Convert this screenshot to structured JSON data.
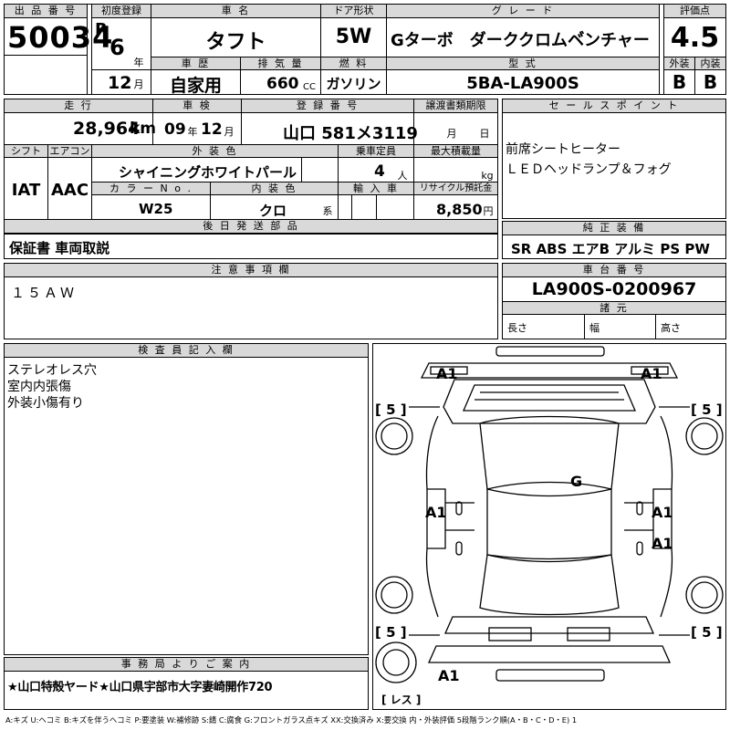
{
  "header": {
    "lot_label": "出 品 番 号",
    "lot_number": "50034",
    "first_reg_label": "初度登録",
    "era": "R",
    "reg_year": "6",
    "year_unit": "年",
    "reg_month": "12",
    "month_unit": "月",
    "car_name_label": "車 名",
    "car_name": "タフト",
    "door_label": "ドア形状",
    "door": "5W",
    "grade_label": "グ レ ー ド",
    "grade": "Gターボ　ダーククロムベ゙ンチャー",
    "score_label": "評価点",
    "score": "4.5",
    "history_label": "車 歴",
    "history": "自家用",
    "displacement_label": "排 気 量",
    "displacement": "660",
    "cc_unit": "CC",
    "fuel_label": "燃 料",
    "fuel": "ガソリン",
    "model_label": "型 式",
    "model": "5BA-LA900S",
    "exterior_label": "外装",
    "exterior_grade": "B",
    "interior_label": "内装",
    "interior_grade": "B"
  },
  "row2": {
    "mileage_label": "走 行",
    "mileage": "28,964",
    "km_unit": "km",
    "inspection_label": "車 検",
    "insp_year": "09",
    "year_unit": "年",
    "insp_month": "12",
    "month_unit": "月",
    "plate_label": "登 録 番 号",
    "plate": "山口 581メ3119",
    "transfer_label": "譲渡書類期限",
    "transfer_month_unit": "月",
    "transfer_day_unit": "日",
    "shift_label": "シフト",
    "shift": "IAT",
    "aircon_label": "エアコン",
    "aircon": "AAC",
    "color_label": "外 装 色",
    "color": "シャイニング゙ホワイトパール",
    "capacity_label": "乗車定員",
    "capacity": "4",
    "person_unit": "人",
    "load_label": "最大積載量",
    "kg_unit": "kg",
    "color_no_label": "カ ラ ー N o .",
    "color_no": "W25",
    "interior_color_label": "内 装 色",
    "interior_color": "クロ",
    "interior_unit": "系",
    "import_label": "輸 入 車",
    "recycle_label": "リサイクル預託金",
    "recycle": "8,850",
    "yen_unit": "円"
  },
  "sales_point": {
    "label": "セ ー ル ス ポ イ ン ト",
    "lines": [
      "前席シートヒーター",
      "ＬＥＤヘッドランプ＆フォグ"
    ]
  },
  "later_parts": {
    "label": "後 日 発 送 部 品",
    "value": "保証書 車両取説"
  },
  "equipment": {
    "label": "純 正 装 備",
    "value": "SR ABS エアB アルミ PS PW"
  },
  "notes": {
    "label": "注 意 事 項 欄",
    "value": "１５ＡＷ"
  },
  "chassis": {
    "label": "車 台 番 号",
    "value": "LA900S-0200967",
    "dims_label": "諸 元",
    "length_label": "長さ",
    "width_label": "幅",
    "height_label": "高さ"
  },
  "inspector": {
    "label": "検 査 員 記 入 欄",
    "lines": [
      "ステレオレス穴",
      "室内内張傷",
      "外装小傷有り"
    ]
  },
  "office": {
    "label": "事 務 局 よ り ご 案 内",
    "value": "★山口特殻ヤード★山口県宇部市大字妻崎開作720"
  },
  "diagram": {
    "marks": {
      "front_left": "A1",
      "front_right": "A1",
      "roof": "G",
      "side_left": "A1",
      "side_right": "A1",
      "side_right_rear": "A1",
      "rear_left": "A1",
      "tire_fl": "[ 5 ]",
      "tire_fr": "[ 5 ]",
      "tire_rl": "[ 5 ]",
      "tire_rr": "[ 5 ]",
      "spare": "[ レス ]"
    }
  },
  "legend": "A:キズ U:ヘコミ B:キズを伴うヘコミ P:要塗装 W:補修跡 S:錆 C:腐食 G:フロントガラス点キズ XX:交換済み X:要交換 内・外装評価 5段階ランク順(A・B・C・D・E) 1"
}
